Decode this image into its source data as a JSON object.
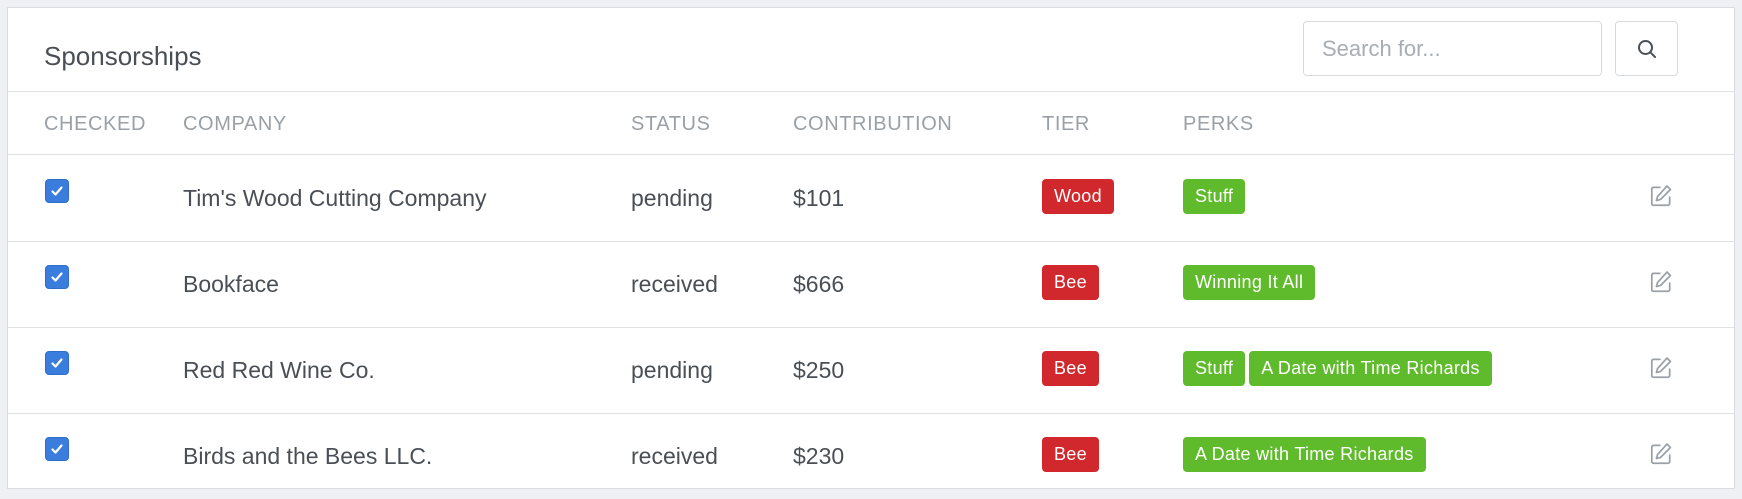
{
  "header": {
    "title": "Sponsorships",
    "search_placeholder": "Search for...",
    "search_icon": "search-icon"
  },
  "columns": [
    "CHECKED",
    "COMPANY",
    "STATUS",
    "CONTRIBUTION",
    "TIER",
    "PERKS"
  ],
  "colors": {
    "tier_badge": "#d0282d",
    "perk_badge": "#5fbb2b",
    "checkbox": "#3b7ddd"
  },
  "rows": [
    {
      "checked": true,
      "company": "Tim's Wood Cutting Company",
      "status": "pending",
      "contribution": "$101",
      "tier": "Wood",
      "perks": [
        "Stuff"
      ]
    },
    {
      "checked": true,
      "company": "Bookface",
      "status": "received",
      "contribution": "$666",
      "tier": "Bee",
      "perks": [
        "Winning It All"
      ]
    },
    {
      "checked": true,
      "company": "Red Red Wine Co.",
      "status": "pending",
      "contribution": "$250",
      "tier": "Bee",
      "perks": [
        "Stuff",
        "A Date with Time Richards"
      ]
    },
    {
      "checked": true,
      "company": "Birds and the Bees LLC.",
      "status": "received",
      "contribution": "$230",
      "tier": "Bee",
      "perks": [
        "A Date with Time Richards"
      ]
    }
  ]
}
